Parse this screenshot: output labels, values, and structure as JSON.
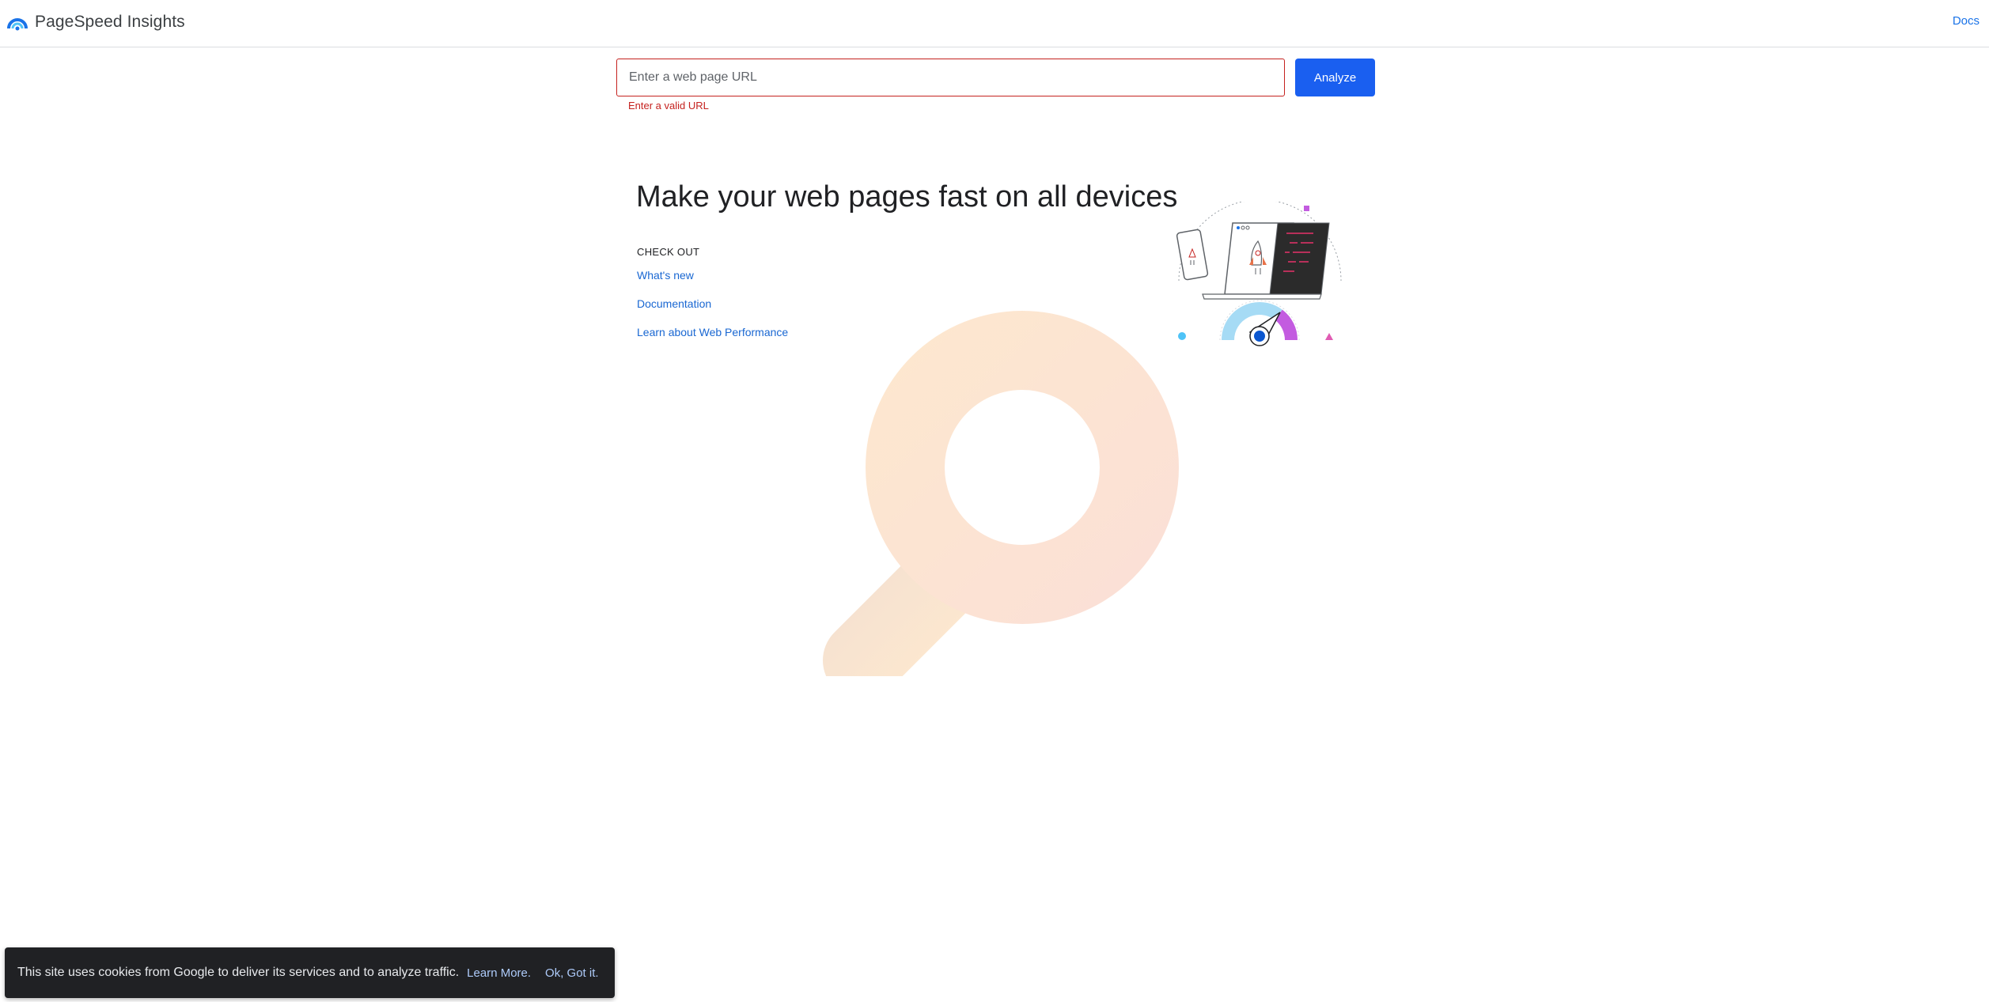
{
  "header": {
    "title": "PageSpeed Insights",
    "logo_icon": "pagespeed-gauge-icon",
    "docs_label": "Docs"
  },
  "search": {
    "placeholder": "Enter a web page URL",
    "value": "",
    "error": "Enter a valid URL",
    "analyze_label": "Analyze"
  },
  "hero": {
    "title": "Make your web pages fast on all devices",
    "checkout_heading": "CHECK OUT",
    "links": [
      {
        "label": "What's new"
      },
      {
        "label": "Documentation"
      },
      {
        "label": "Learn about Web Performance"
      }
    ],
    "illustration_icon": "rocket-speed-devices-illustration",
    "background_icon": "magnifier-icon"
  },
  "cookie_bar": {
    "message": "This site uses cookies from Google to deliver its services and to analyze traffic.",
    "learn_more_label": "Learn More.",
    "ok_label": "Ok, Got it."
  },
  "colors": {
    "accent": "#1a73e8",
    "button": "#1a5ff0",
    "error": "#c5221f",
    "cookie_bg": "#202124"
  }
}
